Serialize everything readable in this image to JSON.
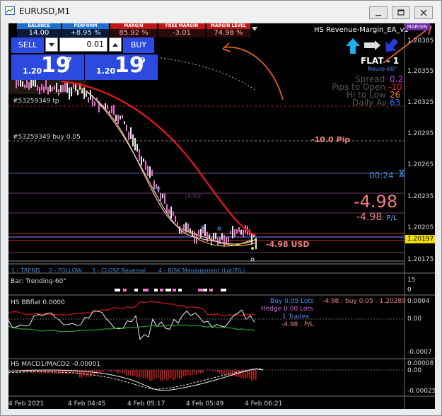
{
  "window": {
    "title": "EURUSD,M1"
  },
  "stats": [
    {
      "header": "BALANCE",
      "value": "14.00",
      "header_color": "#1e6fd0",
      "value_color": "#ffffff"
    },
    {
      "header": "PERFORM",
      "value": "+8.95 %",
      "header_color": "#1e6fd0",
      "value_color": "#bfe2ff"
    },
    {
      "header": "MARGIN",
      "value": "85.92 %",
      "header_color": "#c01818",
      "value_color": "#ffb0b0"
    },
    {
      "header": "FREE MARGIN",
      "value": "-3.01",
      "header_color": "#c01818",
      "value_color": "#ffb0b0"
    },
    {
      "header": "MARGIN LEVEL",
      "value": "74.98 %",
      "header_color": "#c01818",
      "value_color": "#ffb0b0"
    }
  ],
  "trade_panel": {
    "sell_label": "SELL",
    "buy_label": "BUY",
    "lot_value": "0.01",
    "sell_price": {
      "prefix": "1.20",
      "big": "19",
      "sup": "7"
    },
    "buy_price": {
      "prefix": "1.20",
      "big": "19",
      "sup": "9"
    }
  },
  "ea": {
    "name": "HS Revenue-Margin_EA_v1",
    "margin_badge": "MARGIN",
    "state": "FLAT - 1",
    "sub_state": "Neuro-60°",
    "spread_label": "Spread",
    "spread_value": "0.2",
    "pips_label": "Pips to Open",
    "pips_value": "-10",
    "hilo_label": "Hi to Low",
    "hilo_value": "26",
    "daily_label": "Daily Av",
    "daily_value": "63",
    "timer": "00:24",
    "pl_big": "-4.98",
    "pl_small": "-4.98",
    "pl_suffix": ": P/L",
    "usd_label": "-4.98 USD",
    "pip_label": "-10.0 Pip",
    "level_label": "[8/8]P"
  },
  "chart_labels": {
    "tp_line": "#53259349 tp",
    "buy_line": "#53259349 buy 0.05",
    "menu": {
      "trend": "1 - TREND",
      "follow": "2 - FOLLOW",
      "close": "3 - CLOSE Reversal",
      "risk": "4 - RISK Management (Lot/P/L)"
    }
  },
  "price_axis": [
    "1.20385",
    "1.20355",
    "1.20325",
    "1.20295",
    "1.20265",
    "1.20235",
    "1.20205",
    "1.20175"
  ],
  "current_price": "1.20197",
  "time_axis": [
    "4 Feb 2021",
    "4 Feb 04:45",
    "4 Feb 05:17",
    "4 Feb 05:49",
    "4 Feb 06:21"
  ],
  "indicators": {
    "trending": {
      "label": "Bar: Trending-60°",
      "axis_top": "15",
      "axis_bottom": "0"
    },
    "bbflat": {
      "label": "HS BBflat 0.0000",
      "axis": [
        "0.0004",
        "0.00",
        "-0.0007"
      ],
      "buy_lots": "Buy 0.05 Lots",
      "hedge_lots": "Hedge 0.00 Lots",
      "trades": "1 Trades",
      "pl": "-4.98 : P/L",
      "position": "-4.98 : buy 0.05 - 1.20289"
    },
    "macd": {
      "label": "HS MACD1/MACD2 -0.00001",
      "axis": [
        "0.00008",
        "0.00",
        "-0.00025"
      ]
    }
  },
  "colors": {
    "chart_bg": "#000000",
    "ma_red": "#e01818",
    "bull_candle": "#e8e8e8",
    "bear_candle": "#e070c8",
    "annotation": "#e06020",
    "buy_blue": "#2d4ae0"
  }
}
